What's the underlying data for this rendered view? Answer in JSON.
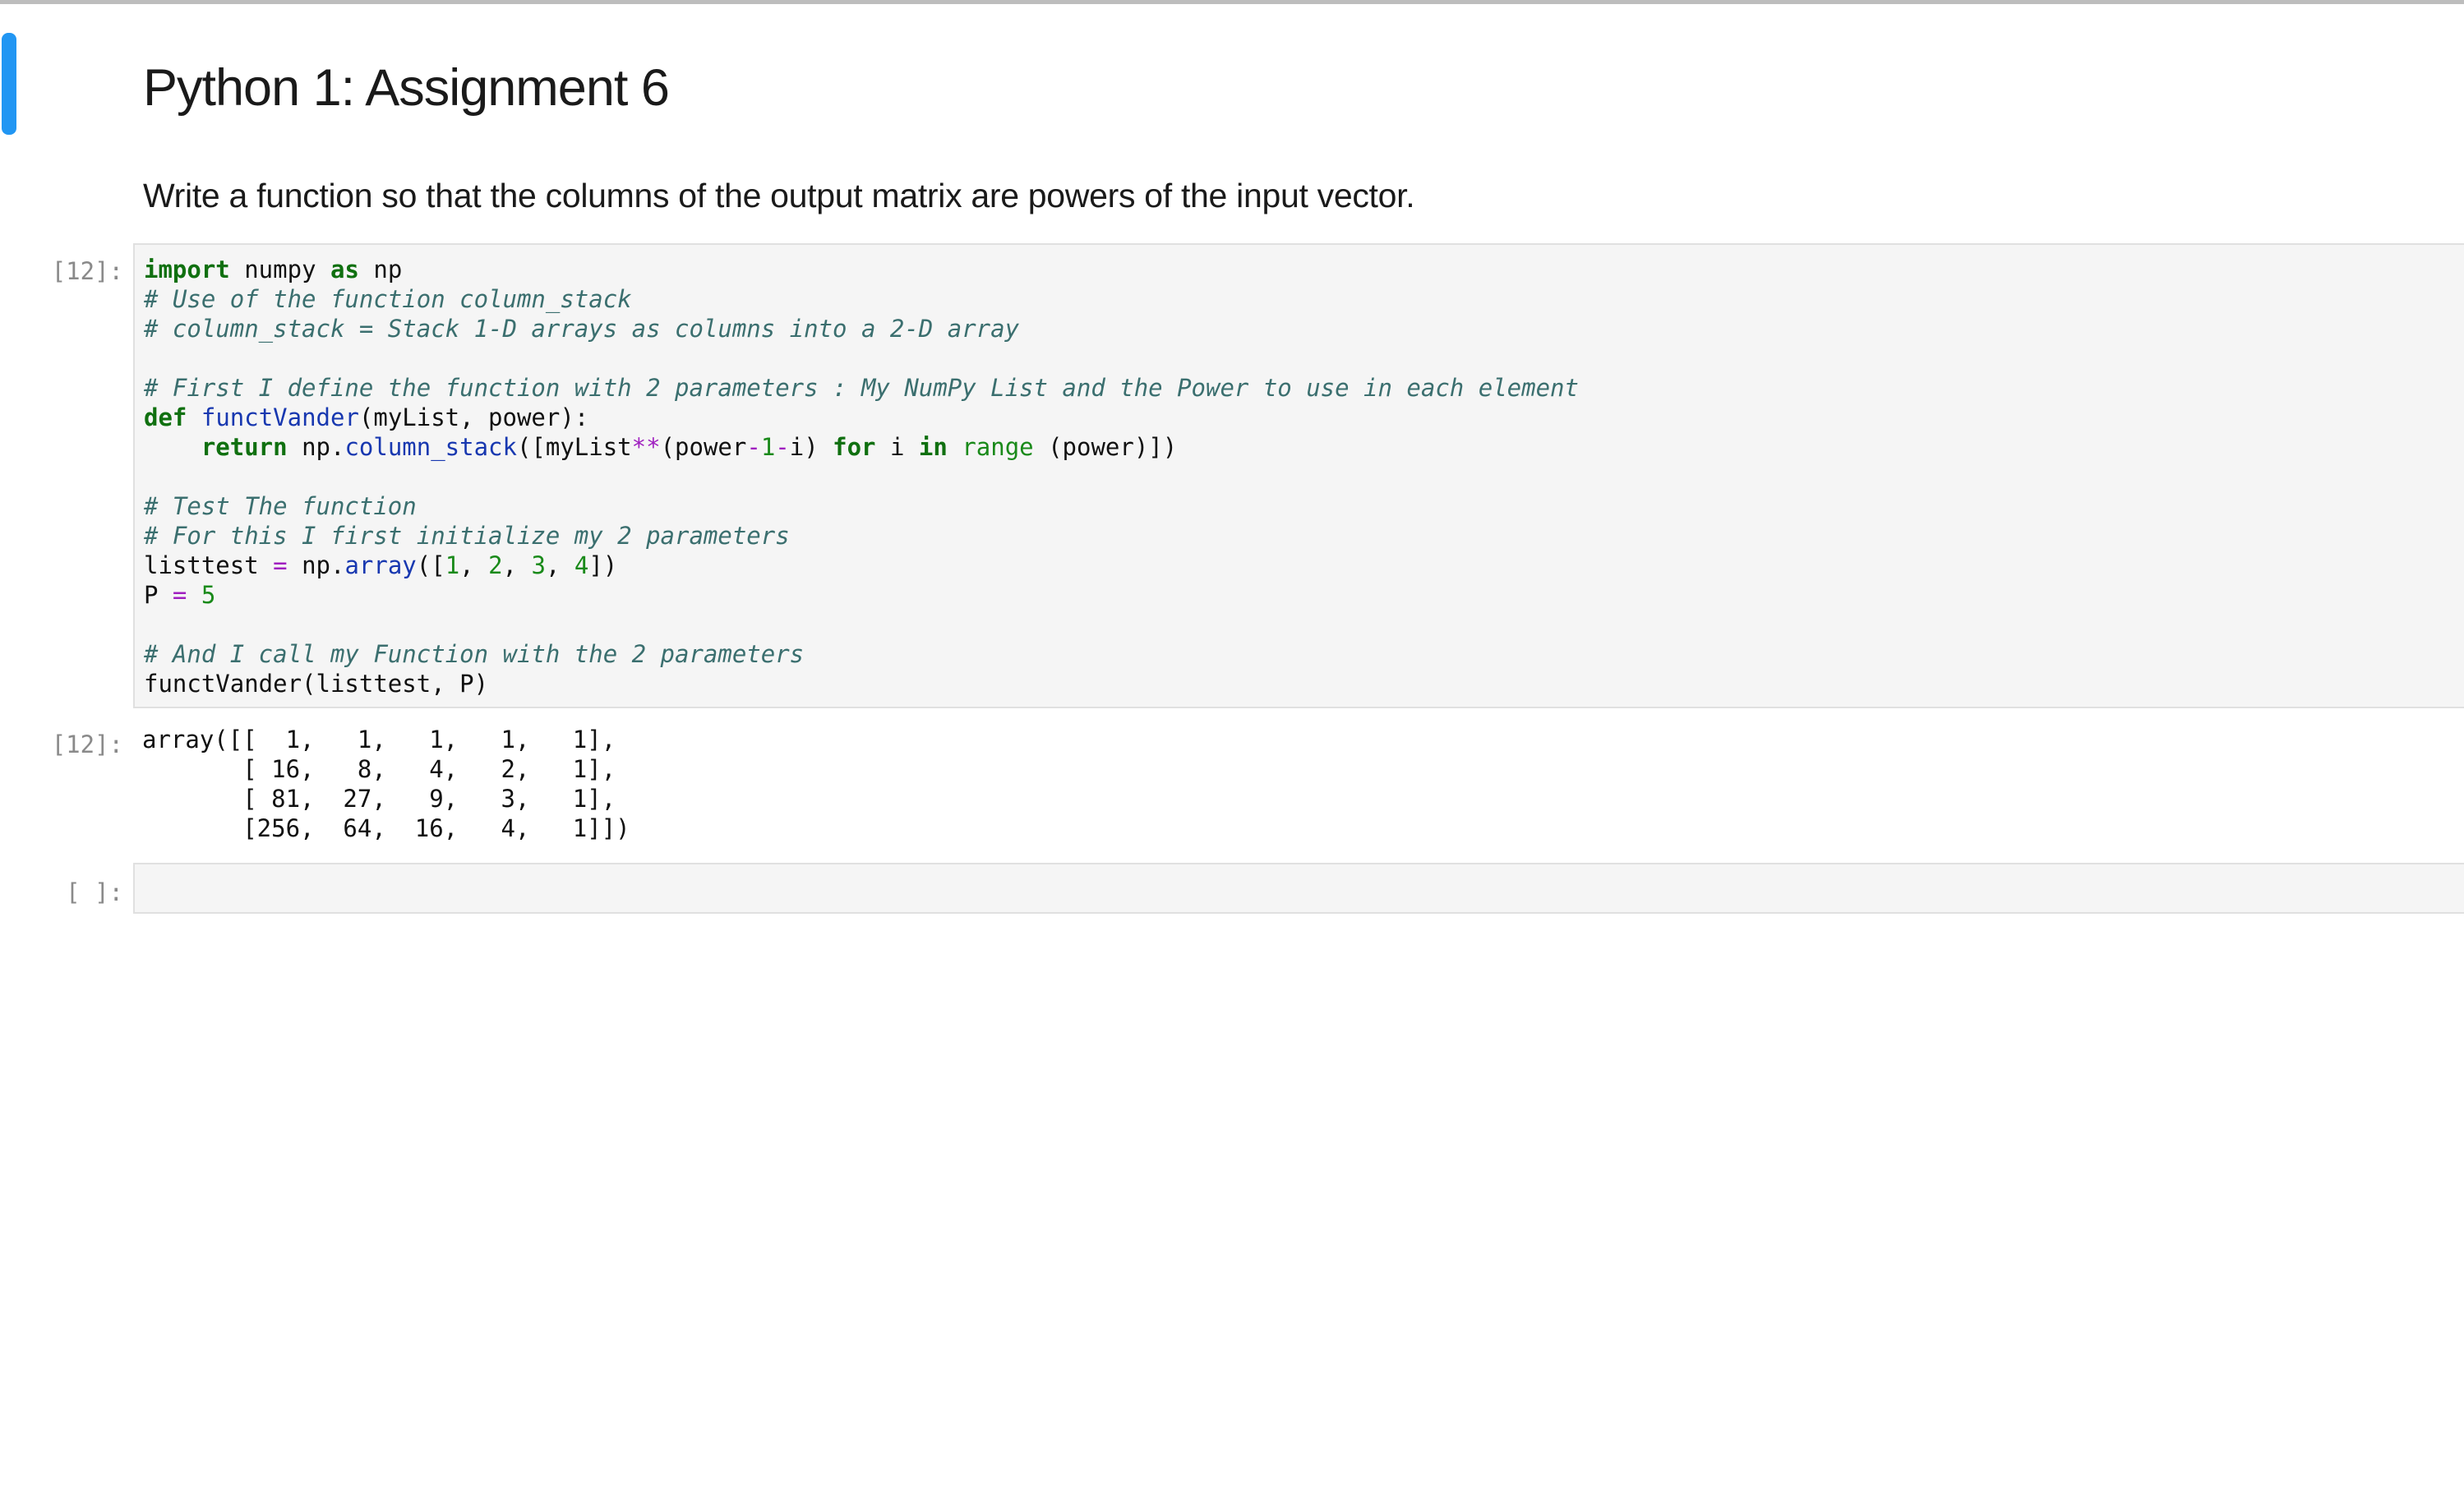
{
  "markdown": {
    "title": "Python 1: Assignment 6",
    "paragraph": "Write a function so that the columns of the output matrix are powers of the input vector."
  },
  "cells": [
    {
      "prompt": "[12]:"
    },
    {
      "output_prompt": "[12]:"
    },
    {
      "prompt": "[ ]:"
    }
  ],
  "code": {
    "l1_kw1": "import",
    "l1_t1": " numpy ",
    "l1_kw2": "as",
    "l1_t2": " np",
    "l2": "# Use of the function column_stack",
    "l3": "# column_stack = Stack 1-D arrays as columns into a 2-D array",
    "l5": "# First I define the function with 2 parameters : My NumPy List and the Power to use in each element",
    "l6_kw": "def",
    "l6_fn": "functVander",
    "l6_rest": "(myList, power):",
    "l7_indent": "    ",
    "l7_kw": "return",
    "l7_t1": " np.",
    "l7_fn": "column_stack",
    "l7_t2": "([myList",
    "l7_op": "**",
    "l7_t3": "(power",
    "l7_op2": "-",
    "l7_num": "1",
    "l7_op3": "-",
    "l7_t4": "i) ",
    "l7_kw2": "for",
    "l7_t5": " i ",
    "l7_kw3": "in",
    "l7_t6": " ",
    "l7_bi": "range",
    "l7_t7": " (power)])",
    "l9": "# Test The function",
    "l10": "# For this I first initialize my 2 parameters",
    "l11_t1": "listtest ",
    "l11_op": "=",
    "l11_t2": " np.",
    "l11_fn": "array",
    "l11_t3": "([",
    "l11_n1": "1",
    "l11_c1": ", ",
    "l11_n2": "2",
    "l11_c2": ", ",
    "l11_n3": "3",
    "l11_c3": ", ",
    "l11_n4": "4",
    "l11_t4": "])",
    "l12_t1": "P ",
    "l12_op": "=",
    "l12_t2": " ",
    "l12_num": "5",
    "l14": "# And I call my Function with the 2 parameters",
    "l15": "functVander(listtest, P)"
  },
  "output": {
    "lines": [
      "array([[  1,   1,   1,   1,   1],",
      "       [ 16,   8,   4,   2,   1],",
      "       [ 81,  27,   9,   3,   1],",
      "       [256,  64,  16,   4,   1]])"
    ]
  }
}
